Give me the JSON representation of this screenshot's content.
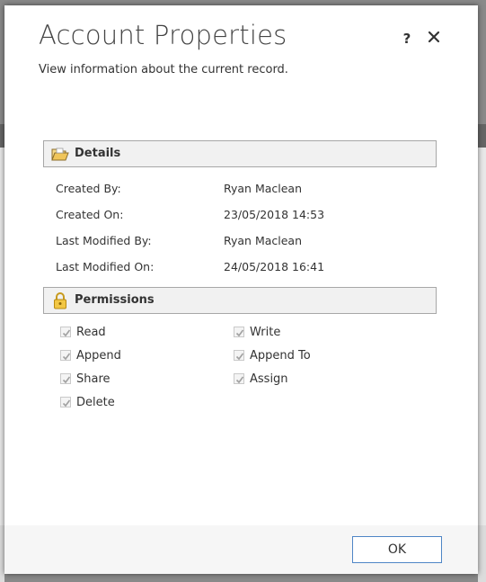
{
  "dialog": {
    "title": "Account Properties",
    "subtitle": "View information about the current record.",
    "help_label": "?",
    "ok_label": "OK"
  },
  "details": {
    "header": "Details",
    "fields": [
      {
        "label": "Created By:",
        "value": "Ryan Maclean"
      },
      {
        "label": "Created On:",
        "value": "23/05/2018 14:53"
      },
      {
        "label": "Last Modified By:",
        "value": "Ryan Maclean"
      },
      {
        "label": "Last Modified On:",
        "value": "24/05/2018 16:41"
      }
    ]
  },
  "permissions": {
    "header": "Permissions",
    "items": [
      {
        "label": "Read",
        "checked": true
      },
      {
        "label": "Write",
        "checked": true
      },
      {
        "label": "Append",
        "checked": true
      },
      {
        "label": "Append To",
        "checked": true
      },
      {
        "label": "Share",
        "checked": true
      },
      {
        "label": "Assign",
        "checked": true
      },
      {
        "label": "Delete",
        "checked": true
      }
    ]
  },
  "colors": {
    "ok_border": "#4f86c6",
    "header_bg": "#f1f1f1",
    "lock_icon": "#e8b634"
  }
}
